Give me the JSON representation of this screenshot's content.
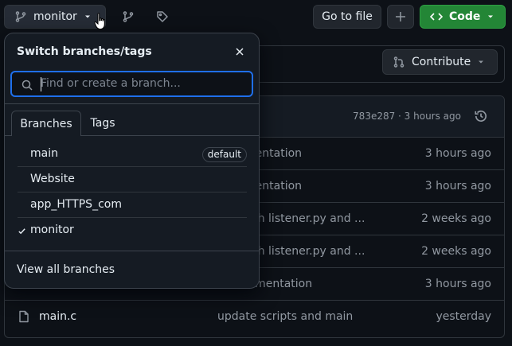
{
  "topbar": {
    "branch_label": "monitor",
    "goto_file_label": "Go to file",
    "code_label": "Code"
  },
  "contribute": {
    "label": "Contribute"
  },
  "table": {
    "commit_meta": "783e287 · 3 hours ago",
    "rows": [
      {
        "name": "",
        "message": "documentation",
        "age": "3 hours ago"
      },
      {
        "name": "",
        "message": "documentation",
        "age": "3 hours ago"
      },
      {
        "name": "",
        "message": "nch with listener.py and ...",
        "age": "2 weeks ago"
      },
      {
        "name": "",
        "message": "nch with listener.py and ...",
        "age": "2 weeks ago"
      },
      {
        "name": "",
        "message": "e documentation",
        "age": "3 hours ago"
      },
      {
        "name": "main.c",
        "message": "update scripts and main",
        "age": "yesterday"
      }
    ]
  },
  "dropdown": {
    "title": "Switch branches/tags",
    "search_placeholder": "Find or create a branch...",
    "tabs": [
      "Branches",
      "Tags"
    ],
    "branches": [
      {
        "name": "main",
        "badge": "default"
      },
      {
        "name": "Website"
      },
      {
        "name": "app_HTTPS_com"
      },
      {
        "name": "monitor",
        "selected": true
      }
    ],
    "view_all_label": "View all branches"
  },
  "colors": {
    "accent": "#1f6feb",
    "code_button": "#238636",
    "background": "#0d1117"
  },
  "icons": [
    "git-branch-icon",
    "chevron-down-icon",
    "tag-icon",
    "plus-icon",
    "code-icon",
    "history-icon",
    "file-icon",
    "close-icon",
    "search-icon",
    "check-icon",
    "git-compare-icon"
  ]
}
